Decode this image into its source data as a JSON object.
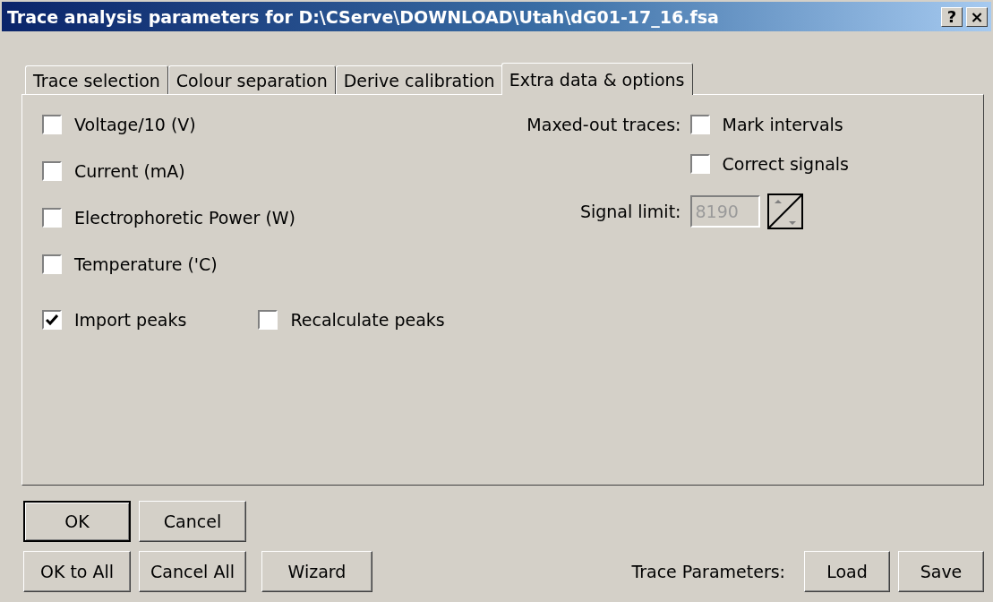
{
  "window": {
    "title": "Trace analysis parameters for D:\\CServe\\DOWNLOAD\\Utah\\dG01-17_16.fsa",
    "buttons": [
      {
        "kind": "help",
        "label": "?"
      },
      {
        "kind": "close",
        "label": "×"
      }
    ]
  },
  "tabs": [
    {
      "label": "Trace selection",
      "selected": false
    },
    {
      "label": "Colour separation",
      "selected": false
    },
    {
      "label": "Derive calibration",
      "selected": false
    },
    {
      "label": "Extra data & options",
      "selected": true
    }
  ],
  "extra_data": [
    {
      "label": "Voltage/10 (V)",
      "checked": false
    },
    {
      "label": "Current (mA)",
      "checked": false
    },
    {
      "label": "Electrophoretic Power (W)",
      "checked": false
    },
    {
      "label": "Temperature ('C)",
      "checked": false
    }
  ],
  "peaks": [
    {
      "label": "Import peaks",
      "checked": true
    },
    {
      "label": "Recalculate peaks",
      "checked": false
    }
  ],
  "maxed_out": {
    "label": "Maxed-out traces:",
    "options": [
      {
        "label": "Mark intervals",
        "checked": false
      },
      {
        "label": "Correct signals",
        "checked": false
      }
    ],
    "signal_limit": {
      "label": "Signal limit:",
      "value": "8190",
      "disabled": true
    }
  },
  "buttons_row_1": [
    {
      "label": "OK",
      "default": true
    },
    {
      "label": "Cancel",
      "default": false
    }
  ],
  "buttons_row_2": [
    {
      "label": "OK to All",
      "default": false
    },
    {
      "label": "Cancel All",
      "default": false
    },
    {
      "label": "Wizard",
      "default": false
    }
  ],
  "trace_parameters": {
    "label": "Trace Parameters:",
    "buttons": [
      "Load",
      "Save"
    ]
  }
}
